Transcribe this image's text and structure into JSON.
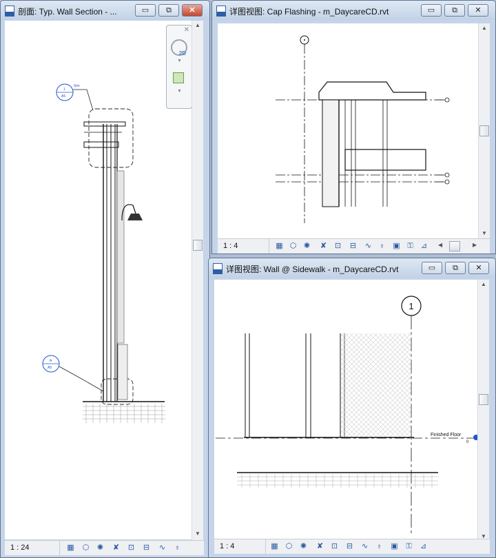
{
  "windows": {
    "section": {
      "title": "剖面: Typ. Wall Section - ...",
      "scale": "1 : 24",
      "navbar": {
        "wheel_label": "2D"
      },
      "callouts": [
        {
          "top": "1",
          "bottom": "A5",
          "tag": "Sim"
        },
        {
          "top": "A",
          "bottom": "A5"
        }
      ]
    },
    "cap_flashing": {
      "title": "详图视图: Cap Flashing - m_DaycareCD.rvt",
      "scale": "1 : 4"
    },
    "sidewalk": {
      "title": "详图视图: Wall @ Sidewalk - m_DaycareCD.rvt",
      "scale": "1 : 4",
      "grid_bubble": "1",
      "level_label": "Finished Floor",
      "level_value": "0"
    }
  },
  "caption_buttons": {
    "minimize": "▭",
    "restore": "⧉",
    "close": "✕"
  },
  "scroll_arrows": {
    "up": "▲",
    "down": "▼",
    "left": "◀",
    "right": "▶"
  },
  "tools": {
    "detail_level": "▦",
    "visual_style": "⬡",
    "sun_path": "✺",
    "shadows": "✘",
    "crop": "⊡",
    "show_crop": "⊟",
    "hide_isolate": "∿",
    "reveal": "♁",
    "lock_3d": "▣",
    "temp_hide": "⚿",
    "analysis": "⊿"
  },
  "colors": {
    "accent": "#2c5aa0",
    "close": "#c4472f",
    "frame": "#c5d4e8"
  }
}
